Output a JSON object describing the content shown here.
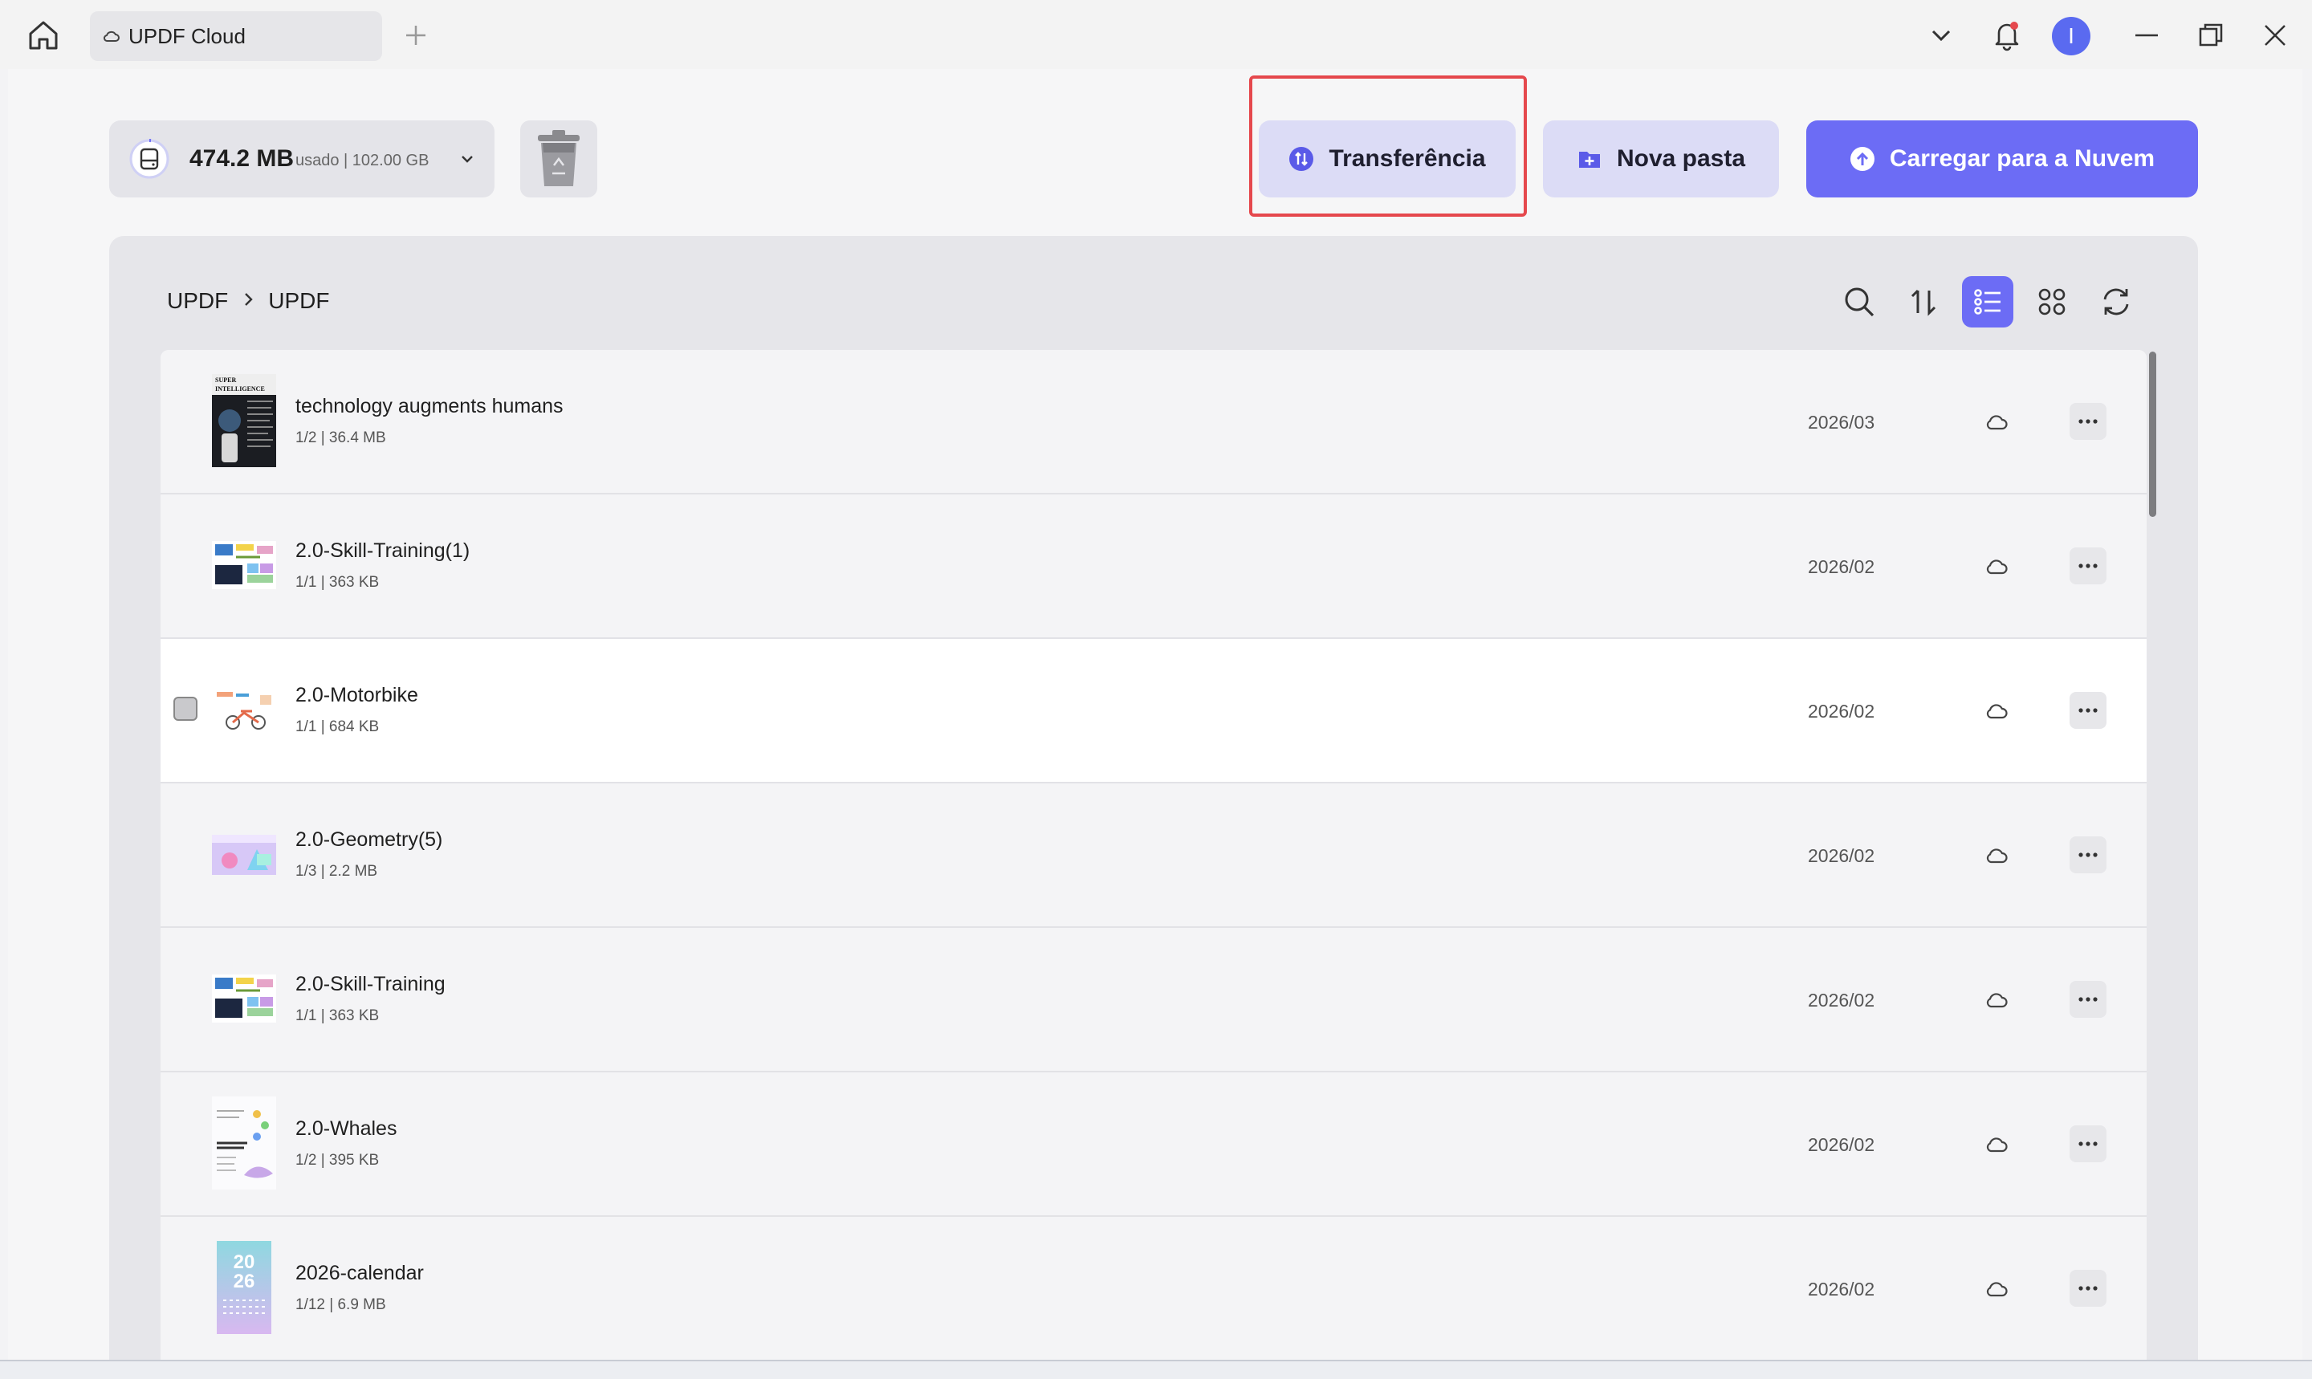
{
  "titlebar": {
    "tab_label": "UPDF Cloud",
    "avatar_initial": "I"
  },
  "storage": {
    "used": "474.2 MB",
    "detail": "usado | 102.00 GB"
  },
  "actions": {
    "transfer_label": "Transferência",
    "new_folder_label": "Nova pasta",
    "upload_label": "Carregar para a Nuvem"
  },
  "breadcrumb": {
    "root": "UPDF",
    "current": "UPDF"
  },
  "colors": {
    "accent": "#6c6cf5",
    "highlight": "#e5484d"
  },
  "files": [
    {
      "name": "technology augments humans",
      "meta": "1/2 | 36.4 MB",
      "date": "2026/03",
      "thumb": "superintelligence-cover",
      "thumb_title": "SUPER INTELLIGENCE"
    },
    {
      "name": "2.0-Skill-Training(1)",
      "meta": "1/1 | 363 KB",
      "date": "2026/02",
      "thumb": "skill-training"
    },
    {
      "name": "2.0-Motorbike",
      "meta": "1/1 | 684 KB",
      "date": "2026/02",
      "thumb": "motorbike",
      "hovered": true
    },
    {
      "name": "2.0-Geometry(5)",
      "meta": "1/3 | 2.2 MB",
      "date": "2026/02",
      "thumb": "geometry"
    },
    {
      "name": "2.0-Skill-Training",
      "meta": "1/1 | 363 KB",
      "date": "2026/02",
      "thumb": "skill-training"
    },
    {
      "name": "2.0-Whales",
      "meta": "1/2 | 395 KB",
      "date": "2026/02",
      "thumb": "whales"
    },
    {
      "name": "2026-calendar",
      "meta": "1/12 | 6.9 MB",
      "date": "2026/02",
      "thumb": "calendar",
      "thumb_title": "20 26"
    }
  ]
}
